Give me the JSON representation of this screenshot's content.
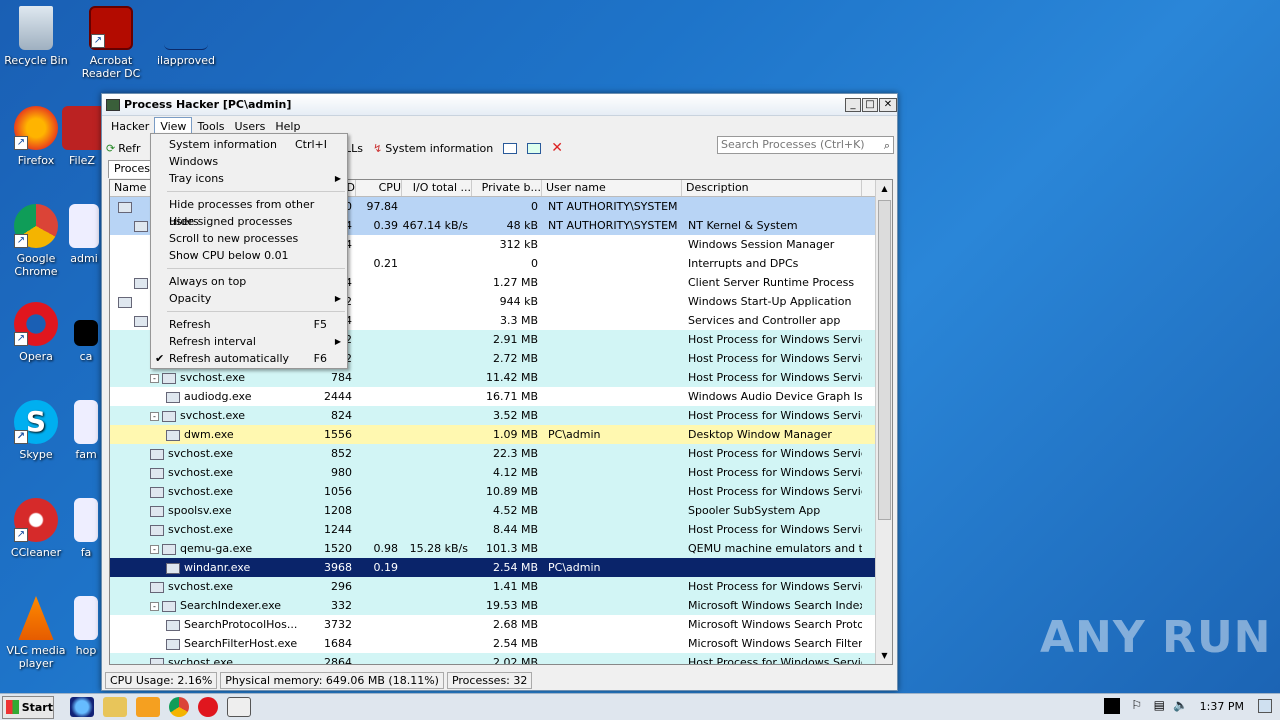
{
  "desktop": {
    "icons": [
      {
        "label": "Recycle Bin",
        "icon": "recycle-bin-icon"
      },
      {
        "label": "Acrobat Reader DC",
        "icon": "acrobat-icon"
      },
      {
        "label": "ilapproved",
        "icon": "file-icon"
      },
      {
        "label": "Firefox",
        "icon": "firefox-icon"
      },
      {
        "label": "FileZ",
        "icon": "filezilla-icon"
      },
      {
        "label": "Google Chrome",
        "icon": "chrome-icon"
      },
      {
        "label": "admi",
        "icon": "file-icon"
      },
      {
        "label": "Opera",
        "icon": "opera-icon"
      },
      {
        "label": "ca",
        "icon": "file-icon"
      },
      {
        "label": "Skype",
        "icon": "skype-icon"
      },
      {
        "label": "fam",
        "icon": "file-icon"
      },
      {
        "label": "CCleaner",
        "icon": "ccleaner-icon"
      },
      {
        "label": "fa",
        "icon": "file-icon"
      },
      {
        "label": "VLC media player",
        "icon": "vlc-icon"
      },
      {
        "label": "hop",
        "icon": "file-icon"
      }
    ]
  },
  "window": {
    "title": "Process Hacker [PC\\admin]",
    "menu": [
      "Hacker",
      "View",
      "Tools",
      "Users",
      "Help"
    ],
    "toolbar": {
      "refresh": "Refr",
      "dlls": "DLLs",
      "sysinfo": "System information"
    },
    "search_placeholder": "Search Processes (Ctrl+K)",
    "tab": "Process",
    "columns": {
      "name": "Name",
      "pid": "D",
      "cpu": "CPU",
      "io": "I/O total ...",
      "priv": "Private b...",
      "user": "User name",
      "desc": "Description"
    },
    "rows": [
      {
        "name": "",
        "pid": "0",
        "cpu": "97.84",
        "io": "",
        "priv": "0",
        "user": "NT AUTHORITY\\SYSTEM",
        "desc": "",
        "bg": "#b8d4f5",
        "indent": 0
      },
      {
        "name": "",
        "pid": "4",
        "cpu": "0.39",
        "io": "467.14 kB/s",
        "priv": "48 kB",
        "user": "NT AUTHORITY\\SYSTEM",
        "desc": "NT Kernel & System",
        "bg": "#b8d4f5",
        "indent": 1
      },
      {
        "name": "",
        "pid": "4",
        "cpu": "",
        "io": "",
        "priv": "312 kB",
        "user": "",
        "desc": "Windows Session Manager",
        "bg": "#ffffff",
        "indent": 2
      },
      {
        "name": "",
        "pid": "",
        "cpu": "0.21",
        "io": "",
        "priv": "0",
        "user": "",
        "desc": "Interrupts and DPCs",
        "bg": "#ffffff",
        "indent": 2
      },
      {
        "name": "",
        "pid": "4",
        "cpu": "",
        "io": "",
        "priv": "1.27 MB",
        "user": "",
        "desc": "Client Server Runtime Process",
        "bg": "#ffffff",
        "indent": 1
      },
      {
        "name": "",
        "pid": "2",
        "cpu": "",
        "io": "",
        "priv": "944 kB",
        "user": "",
        "desc": "Windows Start-Up Application",
        "bg": "#ffffff",
        "indent": 0
      },
      {
        "name": "",
        "pid": "4",
        "cpu": "",
        "io": "",
        "priv": "3.3 MB",
        "user": "",
        "desc": "Services and Controller app",
        "bg": "#ffffff",
        "indent": 1
      },
      {
        "name": "",
        "pid": "2",
        "cpu": "",
        "io": "",
        "priv": "2.91 MB",
        "user": "",
        "desc": "Host Process for Windows Services",
        "bg": "#d2f5f5",
        "indent": 2
      },
      {
        "name": "",
        "pid": "2",
        "cpu": "",
        "io": "",
        "priv": "2.72 MB",
        "user": "",
        "desc": "Host Process for Windows Services",
        "bg": "#d2f5f5",
        "indent": 2
      },
      {
        "name": "svchost.exe",
        "pid": "784",
        "cpu": "",
        "io": "",
        "priv": "11.42 MB",
        "user": "",
        "desc": "Host Process for Windows Services",
        "bg": "#d2f5f5",
        "indent": 2,
        "tog": "-"
      },
      {
        "name": "audiodg.exe",
        "pid": "2444",
        "cpu": "",
        "io": "",
        "priv": "16.71 MB",
        "user": "",
        "desc": "Windows Audio Device Graph Is...",
        "bg": "#ffffff",
        "indent": 3
      },
      {
        "name": "svchost.exe",
        "pid": "824",
        "cpu": "",
        "io": "",
        "priv": "3.52 MB",
        "user": "",
        "desc": "Host Process for Windows Services",
        "bg": "#d2f5f5",
        "indent": 2,
        "tog": "-"
      },
      {
        "name": "dwm.exe",
        "pid": "1556",
        "cpu": "",
        "io": "",
        "priv": "1.09 MB",
        "user": "PC\\admin",
        "desc": "Desktop Window Manager",
        "bg": "#fff8b0",
        "indent": 3
      },
      {
        "name": "svchost.exe",
        "pid": "852",
        "cpu": "",
        "io": "",
        "priv": "22.3 MB",
        "user": "",
        "desc": "Host Process for Windows Services",
        "bg": "#d2f5f5",
        "indent": 2
      },
      {
        "name": "svchost.exe",
        "pid": "980",
        "cpu": "",
        "io": "",
        "priv": "4.12 MB",
        "user": "",
        "desc": "Host Process for Windows Services",
        "bg": "#d2f5f5",
        "indent": 2
      },
      {
        "name": "svchost.exe",
        "pid": "1056",
        "cpu": "",
        "io": "",
        "priv": "10.89 MB",
        "user": "",
        "desc": "Host Process for Windows Services",
        "bg": "#d2f5f5",
        "indent": 2
      },
      {
        "name": "spoolsv.exe",
        "pid": "1208",
        "cpu": "",
        "io": "",
        "priv": "4.52 MB",
        "user": "",
        "desc": "Spooler SubSystem App",
        "bg": "#d2f5f5",
        "indent": 2
      },
      {
        "name": "svchost.exe",
        "pid": "1244",
        "cpu": "",
        "io": "",
        "priv": "8.44 MB",
        "user": "",
        "desc": "Host Process for Windows Services",
        "bg": "#d2f5f5",
        "indent": 2
      },
      {
        "name": "qemu-ga.exe",
        "pid": "1520",
        "cpu": "0.98",
        "io": "15.28 kB/s",
        "priv": "101.3 MB",
        "user": "",
        "desc": "QEMU machine emulators and tools",
        "bg": "#d2f5f5",
        "indent": 2,
        "tog": "-"
      },
      {
        "name": "windanr.exe",
        "pid": "3968",
        "cpu": "0.19",
        "io": "",
        "priv": "2.54 MB",
        "user": "PC\\admin",
        "desc": "",
        "bg": "#0a246a",
        "fg": "#ffffff",
        "indent": 3
      },
      {
        "name": "svchost.exe",
        "pid": "296",
        "cpu": "",
        "io": "",
        "priv": "1.41 MB",
        "user": "",
        "desc": "Host Process for Windows Services",
        "bg": "#d2f5f5",
        "indent": 2
      },
      {
        "name": "SearchIndexer.exe",
        "pid": "332",
        "cpu": "",
        "io": "",
        "priv": "19.53 MB",
        "user": "",
        "desc": "Microsoft Windows Search Indexer",
        "bg": "#d2f5f5",
        "indent": 2,
        "tog": "-"
      },
      {
        "name": "SearchProtocolHos...",
        "pid": "3732",
        "cpu": "",
        "io": "",
        "priv": "2.68 MB",
        "user": "",
        "desc": "Microsoft Windows Search Proto...",
        "bg": "#ffffff",
        "indent": 3
      },
      {
        "name": "SearchFilterHost.exe",
        "pid": "1684",
        "cpu": "",
        "io": "",
        "priv": "2.54 MB",
        "user": "",
        "desc": "Microsoft Windows Search Filter ...",
        "bg": "#ffffff",
        "indent": 3
      },
      {
        "name": "svchost.exe",
        "pid": "2864",
        "cpu": "",
        "io": "",
        "priv": "2.02 MB",
        "user": "",
        "desc": "Host Process for Windows Services",
        "bg": "#d2f5f5",
        "indent": 2
      }
    ],
    "status": {
      "cpu": "CPU Usage: 2.16%",
      "mem": "Physical memory: 649.06 MB (18.11%)",
      "procs": "Processes: 32"
    }
  },
  "view_menu": {
    "items": [
      {
        "label": "System information",
        "shortcut": "Ctrl+I"
      },
      {
        "label": "Windows"
      },
      {
        "label": "Tray icons",
        "submenu": true
      },
      {
        "sep": true
      },
      {
        "label": "Hide processes from other users"
      },
      {
        "label": "Hide signed processes"
      },
      {
        "label": "Scroll to new processes"
      },
      {
        "label": "Show CPU below 0.01"
      },
      {
        "sep": true
      },
      {
        "label": "Always on top"
      },
      {
        "label": "Opacity",
        "submenu": true
      },
      {
        "sep": true
      },
      {
        "label": "Refresh",
        "shortcut": "F5"
      },
      {
        "label": "Refresh interval",
        "submenu": true
      },
      {
        "label": "Refresh automatically",
        "shortcut": "F6",
        "checked": true
      }
    ]
  },
  "taskbar": {
    "start": "Start",
    "clock": "1:37 PM"
  },
  "watermark": "ANY RUN"
}
